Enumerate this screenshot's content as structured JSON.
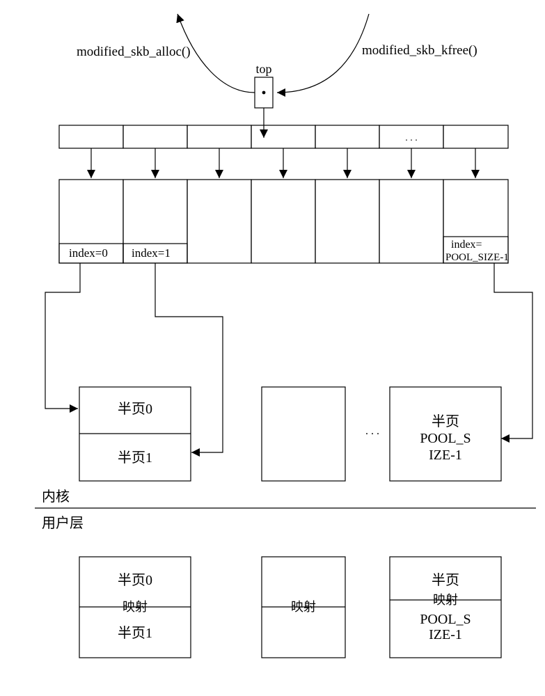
{
  "labels": {
    "alloc": "modified_skb_alloc()",
    "kfree": "modified_skb_kfree()",
    "top": "top",
    "ellipsis": ". . .",
    "idx0": "index=0",
    "idx1": "index=1",
    "idxLastA": "index=",
    "idxLastB": "POOL_SIZE-1",
    "half0": "半页0",
    "half1": "半页1",
    "halfLastA": "半页",
    "halfLastB": "POOL_S",
    "halfLastC": "IZE-1",
    "kernel": "内核",
    "user": "用户层",
    "map": "映射"
  }
}
